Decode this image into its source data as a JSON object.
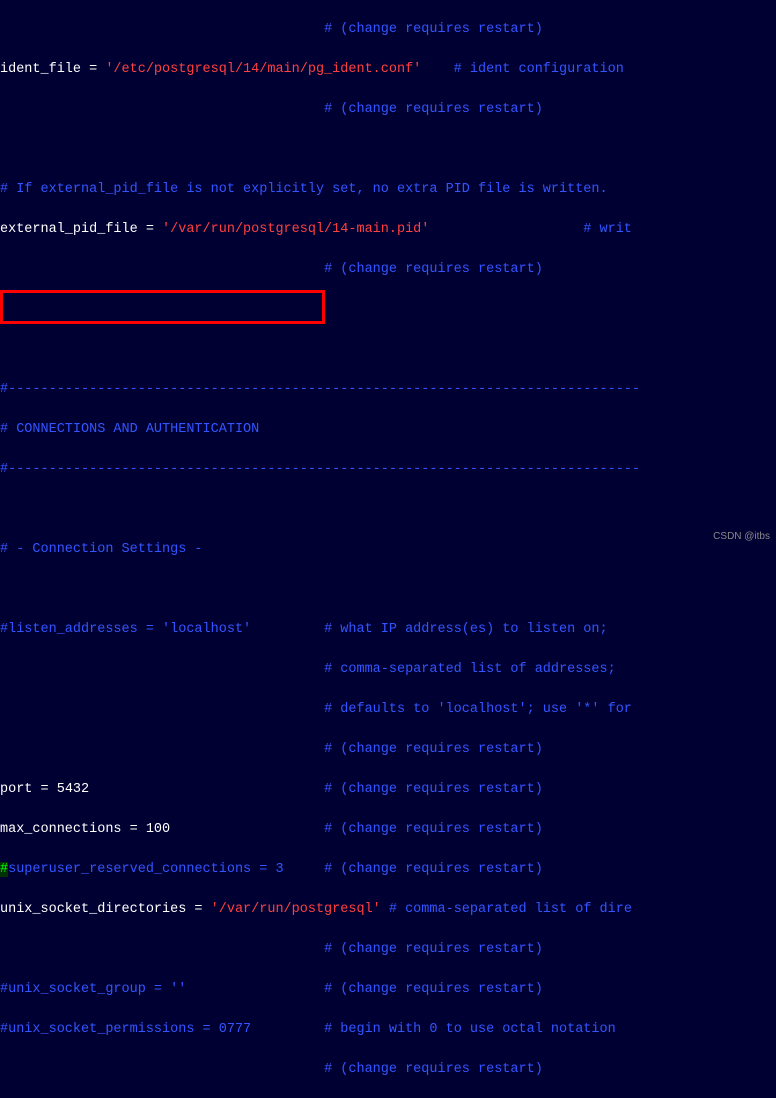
{
  "lines": {
    "l01_a": "                                        ",
    "l01_b": "# (change requires restart)",
    "l02_a": "ident_file = ",
    "l02_b": "'/etc/postgresql/14/main/pg_ident.conf'",
    "l02_c": "    # ident configuration",
    "l03_a": "                                        ",
    "l03_b": "# (change requires restart)",
    "l04": "",
    "l05": "# If external_pid_file is not explicitly set, no extra PID file is written.",
    "l06_a": "external_pid_file = ",
    "l06_b": "'/var/run/postgresql/14-main.pid'",
    "l06_c": "                   # writ",
    "l07_a": "                                        ",
    "l07_b": "# (change requires restart)",
    "l08": "",
    "l09": "",
    "l10": "#------------------------------------------------------------------------------",
    "l11": "# CONNECTIONS AND AUTHENTICATION",
    "l12": "#------------------------------------------------------------------------------",
    "l13": "",
    "l14": "# - Connection Settings -",
    "l15": "",
    "l16_a": "#listen_addresses = ",
    "l16_b": "'localhost'",
    "l16_c": "         # what IP address(es) to listen on;",
    "l17_a": "                                        ",
    "l17_b": "# comma-separated list of addresses;",
    "l18_a": "                                        ",
    "l18_b": "# defaults to 'localhost'; use '*' for",
    "l19_a": "                                        ",
    "l19_b": "# (change requires restart)",
    "l20_a": "port = ",
    "l20_b": "5432",
    "l20_c": "                             # (change requires restart)",
    "l21_a": "max_connections = ",
    "l21_b": "100",
    "l21_c": "                   # (change requires restart)",
    "l22_a": "#",
    "l22_b": "superuser_reserved_connections = 3",
    "l22_c": "     # (change requires restart)",
    "l23_a": "unix_socket_directories = ",
    "l23_b": "'/var/run/postgresql'",
    "l23_c": " # comma-separated list of dire",
    "l24_a": "                                        ",
    "l24_b": "# (change requires restart)",
    "l25_a": "#unix_socket_group = ",
    "l25_b": "''",
    "l25_c": "                 # (change requires restart)",
    "l26_a": "#unix_socket_permissions = ",
    "l26_b": "0777",
    "l26_c": "         # begin with 0 to use octal notation",
    "l27_a": "                                        ",
    "l27_b": "# (change requires restart)"
  },
  "watermark": "CSDN @itbs"
}
